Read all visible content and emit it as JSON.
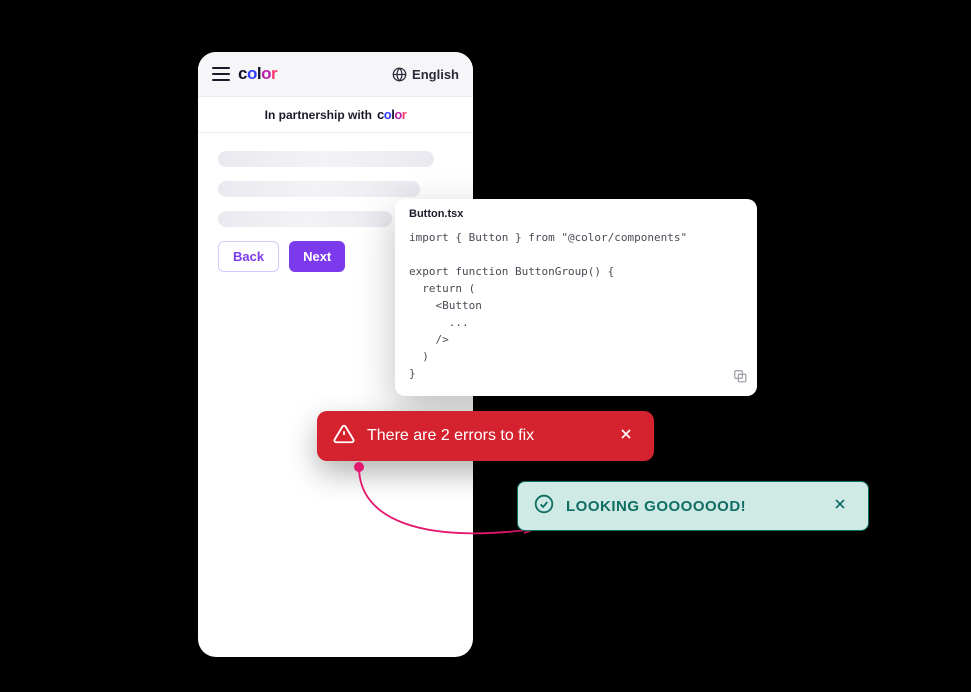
{
  "phone": {
    "language_label": "English",
    "partnership_text": "In partnership with",
    "back_label": "Back",
    "next_label": "Next"
  },
  "code": {
    "filename": "Button.tsx",
    "body": "import { Button } from \"@color/components\"\n\nexport function ButtonGroup() {\n  return (\n    <Button\n      ...\n    />\n  )\n}"
  },
  "error_toast": {
    "message": "There are 2 errors to fix"
  },
  "success_toast": {
    "message": "LOOKING GOOOOOOD!"
  }
}
